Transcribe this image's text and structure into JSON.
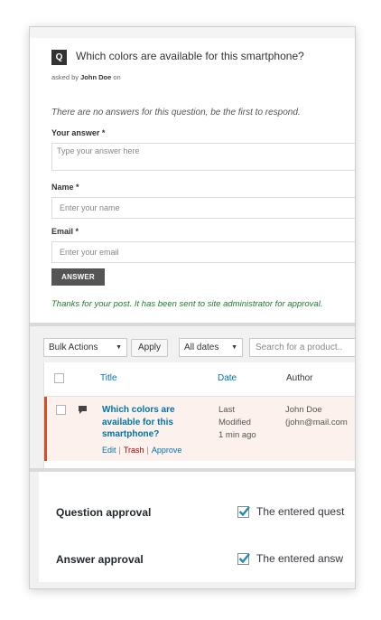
{
  "question": {
    "badge": "Q",
    "title": "Which colors are available for this smartphone?",
    "asked_prefix": "asked by",
    "asked_user": "John Doe",
    "asked_suffix": "on",
    "no_answers": "There are no answers for this question, be the first to respond."
  },
  "form": {
    "answer_label": "Your answer *",
    "answer_placeholder": "Type your answer here",
    "name_label": "Name *",
    "name_placeholder": "Enter your name",
    "email_label": "Email *",
    "email_placeholder": "Enter your email",
    "submit_label": "ANSWER",
    "thanks": "Thanks for your post. It has been sent to site administrator for approval."
  },
  "list": {
    "bulk_actions": "Bulk Actions",
    "apply": "Apply",
    "all_dates": "All dates",
    "search_placeholder": "Search for a product..",
    "columns": {
      "title": "Title",
      "date": "Date",
      "author": "Author"
    },
    "row": {
      "title_lines": [
        "Which colors are",
        "available for this",
        "smartphone?"
      ],
      "actions": {
        "edit": "Edit",
        "trash": "Trash",
        "approve": "Approve",
        "sep": "|"
      },
      "date_lines": [
        "Last",
        "Modified",
        "1 min ago"
      ],
      "author_lines": [
        "John Doe",
        "(john@mail.com"
      ]
    }
  },
  "settings": [
    {
      "label": "Question approval",
      "text": "The entered quest",
      "checked": true
    },
    {
      "label": "Answer approval",
      "text": "The entered answ",
      "checked": true
    }
  ],
  "colors": {
    "link": "#0073aa",
    "trash": "#aa0000",
    "thanks": "#237a2e",
    "row_accent": "#d54e21",
    "check": "#1e8cbe"
  }
}
